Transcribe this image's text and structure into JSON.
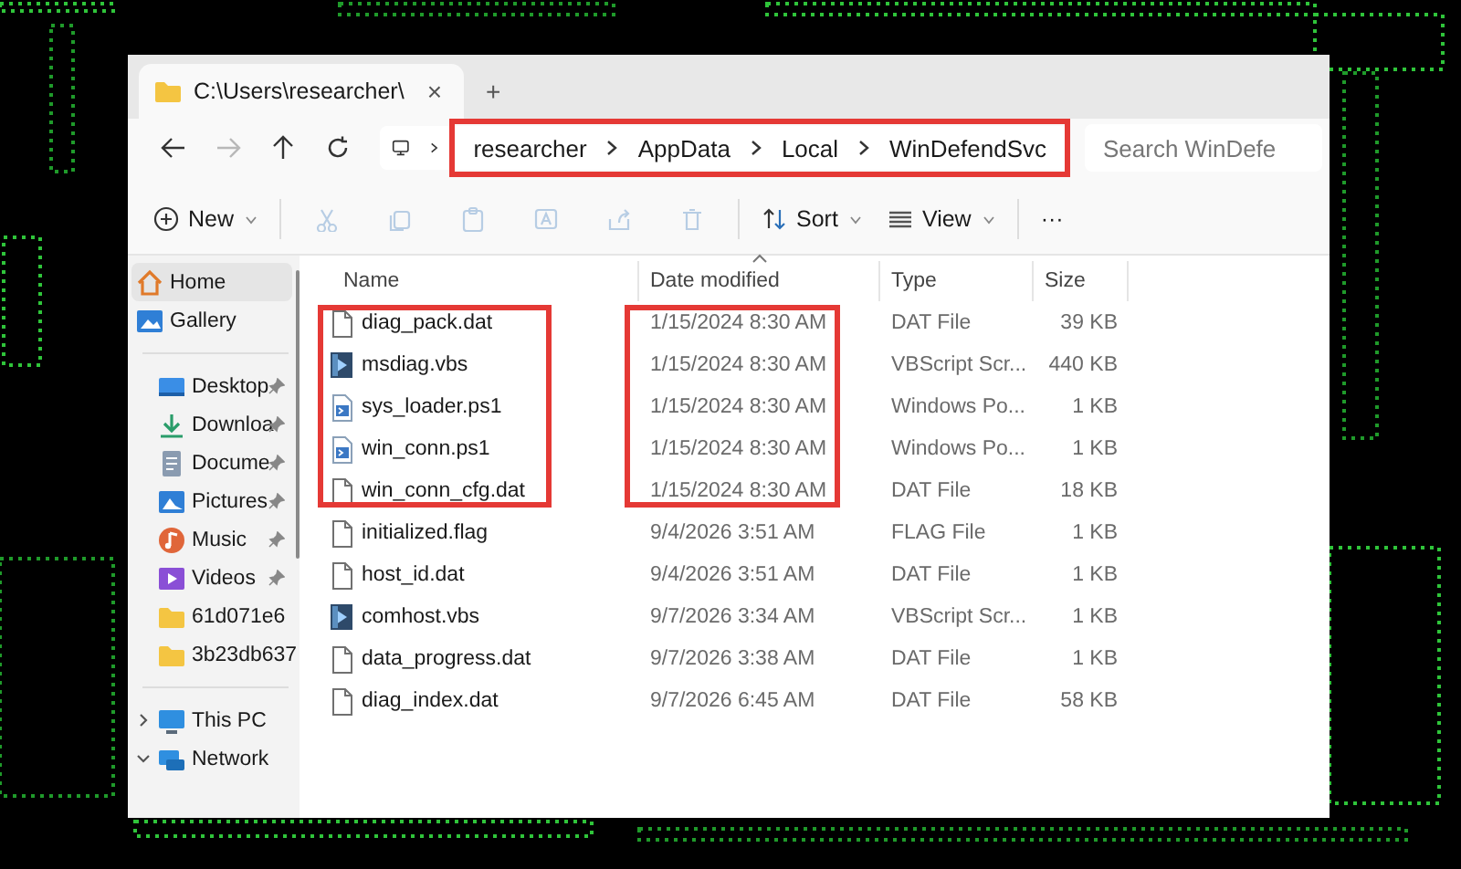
{
  "tab": {
    "title": "C:\\Users\\researcher\\",
    "close": "×",
    "new_tab": "+"
  },
  "nav": {
    "back_disabled": false,
    "forward_disabled": true,
    "up_disabled": false
  },
  "address_bar": {
    "crumbs": [
      "researcher",
      "AppData",
      "Local",
      "WinDefendSvc"
    ],
    "highlighted": true
  },
  "search": {
    "placeholder": "Search WinDefe"
  },
  "toolbar": {
    "new": "New",
    "sort": "Sort",
    "view": "View",
    "more": "···",
    "edit_actions_disabled": true
  },
  "sidebar": {
    "sections": [
      {
        "items": [
          {
            "label": "Home",
            "kind": "home",
            "selected": true,
            "pinned": false
          },
          {
            "label": "Gallery",
            "kind": "gallery",
            "selected": false,
            "pinned": false
          }
        ]
      },
      {
        "items": [
          {
            "label": "Desktop",
            "kind": "desktop",
            "selected": false,
            "pinned": true
          },
          {
            "label": "Downloa",
            "kind": "downloads",
            "selected": false,
            "pinned": true
          },
          {
            "label": "Docume",
            "kind": "documents",
            "selected": false,
            "pinned": true
          },
          {
            "label": "Pictures",
            "kind": "pictures",
            "selected": false,
            "pinned": true
          },
          {
            "label": "Music",
            "kind": "music",
            "selected": false,
            "pinned": true
          },
          {
            "label": "Videos",
            "kind": "videos",
            "selected": false,
            "pinned": true
          },
          {
            "label": "61d071e6",
            "kind": "folder",
            "selected": false,
            "pinned": false
          },
          {
            "label": "3b23db637",
            "kind": "folder",
            "selected": false,
            "pinned": false
          }
        ]
      },
      {
        "items": [
          {
            "label": "This PC",
            "kind": "pc",
            "selected": false,
            "pinned": false,
            "expanded": false
          },
          {
            "label": "Network",
            "kind": "network",
            "selected": false,
            "pinned": false,
            "expanded": true
          }
        ]
      }
    ]
  },
  "files": {
    "columns": [
      {
        "label": "Name",
        "sorted": false
      },
      {
        "label": "Date modified",
        "sorted": true
      },
      {
        "label": "Type",
        "sorted": false
      },
      {
        "label": "Size",
        "sorted": false
      }
    ],
    "rows": [
      {
        "name": "diag_pack.dat",
        "date": "1/15/2024 8:30 AM",
        "type": "DAT File",
        "size": "39 KB",
        "kind": "file",
        "highlighted": true
      },
      {
        "name": "msdiag.vbs",
        "date": "1/15/2024 8:30 AM",
        "type": "VBScript Scr...",
        "size": "440 KB",
        "kind": "vbs",
        "highlighted": true
      },
      {
        "name": "sys_loader.ps1",
        "date": "1/15/2024 8:30 AM",
        "type": "Windows Po...",
        "size": "1 KB",
        "kind": "ps1",
        "highlighted": true
      },
      {
        "name": "win_conn.ps1",
        "date": "1/15/2024 8:30 AM",
        "type": "Windows Po...",
        "size": "1 KB",
        "kind": "ps1",
        "highlighted": true
      },
      {
        "name": "win_conn_cfg.dat",
        "date": "1/15/2024 8:30 AM",
        "type": "DAT File",
        "size": "18 KB",
        "kind": "file",
        "highlighted": true
      },
      {
        "name": "initialized.flag",
        "date": "9/4/2026 3:51 AM",
        "type": "FLAG File",
        "size": "1 KB",
        "kind": "file",
        "highlighted": false
      },
      {
        "name": "host_id.dat",
        "date": "9/4/2026 3:51 AM",
        "type": "DAT File",
        "size": "1 KB",
        "kind": "file",
        "highlighted": false
      },
      {
        "name": "comhost.vbs",
        "date": "9/7/2026 3:34 AM",
        "type": "VBScript Scr...",
        "size": "1 KB",
        "kind": "vbs",
        "highlighted": false
      },
      {
        "name": "data_progress.dat",
        "date": "9/7/2026 3:38 AM",
        "type": "DAT File",
        "size": "1 KB",
        "kind": "file",
        "highlighted": false
      },
      {
        "name": "diag_index.dat",
        "date": "9/7/2026 6:45 AM",
        "type": "DAT File",
        "size": "58 KB",
        "kind": "file",
        "highlighted": false
      }
    ]
  }
}
